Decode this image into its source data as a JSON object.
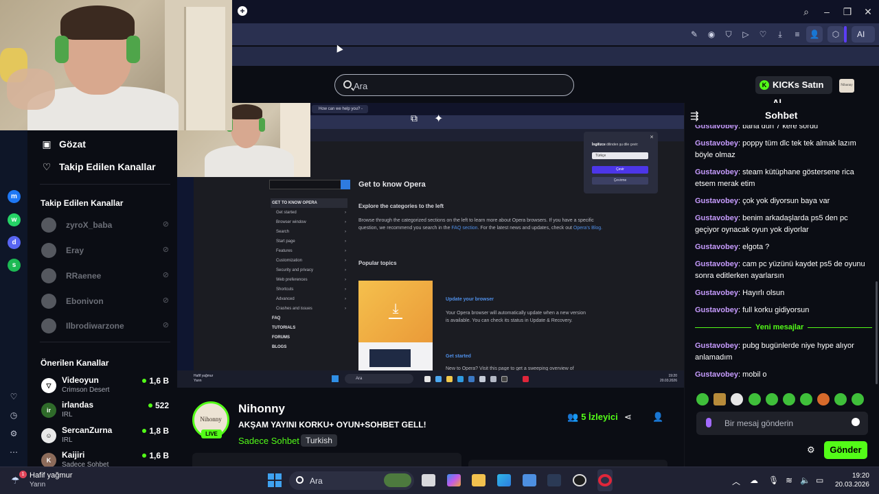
{
  "topbar": {
    "ai_label": "AI"
  },
  "kick": {
    "search_placeholder": "Ara",
    "kicks_button": "KICKs Satın Al",
    "mini_avatar_text": "Nihonny"
  },
  "sidebar": {
    "nav": [
      {
        "icon": "browse-icon",
        "label": "Gözat"
      },
      {
        "icon": "heart-icon",
        "label": "Takip Edilen Kanallar"
      }
    ],
    "followed_title": "Takip Edilen Kanallar",
    "followed": [
      "zyroX_baba",
      "Eray",
      "RRaenee",
      "Ebonivon",
      "Ilbrodiwarzone"
    ],
    "recommended_title": "Önerilen Kanallar",
    "recommended": [
      {
        "name": "Videoyun",
        "category": "Crimson Desert",
        "viewers": "1,6 B"
      },
      {
        "name": "irlandas",
        "category": "IRL",
        "viewers": "522"
      },
      {
        "name": "SercanZurna",
        "category": "IRL",
        "viewers": "1,8 B"
      },
      {
        "name": "Kaijiri",
        "category": "Sadece Sohbet",
        "viewers": "1,6 B"
      }
    ]
  },
  "video": {
    "tab_label": "How can we help you? -",
    "page_heading": "Get to know Opera",
    "explore_heading": "Explore the categories to the left",
    "explore_text": "Browse through the categorized sections on the left to learn more about Opera browsers. If you have a specific question, we recommend you search in the",
    "faq_link": "FAQ section",
    "explore_text2": ". For the latest news and updates, check out",
    "blog_link": "Opera's Blog.",
    "popular_heading": "Popular topics",
    "menu": [
      {
        "label": "GET TO KNOW OPERA",
        "top": true,
        "hl": true,
        "arrow": false
      },
      {
        "label": "Get started",
        "top": false,
        "hl": false,
        "arrow": true
      },
      {
        "label": "Browser window",
        "top": false,
        "hl": false,
        "arrow": true
      },
      {
        "label": "Search",
        "top": false,
        "hl": false,
        "arrow": true
      },
      {
        "label": "Start page",
        "top": false,
        "hl": false,
        "arrow": true
      },
      {
        "label": "Features",
        "top": false,
        "hl": false,
        "arrow": true
      },
      {
        "label": "Customization",
        "top": false,
        "hl": false,
        "arrow": true
      },
      {
        "label": "Security and privacy",
        "top": false,
        "hl": false,
        "arrow": true
      },
      {
        "label": "Web preferences",
        "top": false,
        "hl": false,
        "arrow": true
      },
      {
        "label": "Shortcuts",
        "top": false,
        "hl": false,
        "arrow": true
      },
      {
        "label": "Advanced",
        "top": false,
        "hl": false,
        "arrow": true
      },
      {
        "label": "Crashes and issues",
        "top": false,
        "hl": false,
        "arrow": true
      },
      {
        "label": "FAQ",
        "top": true,
        "hl": false,
        "arrow": false
      },
      {
        "label": "TUTORIALS",
        "top": true,
        "hl": false,
        "arrow": false
      },
      {
        "label": "FORUMS",
        "top": true,
        "hl": false,
        "arrow": false
      },
      {
        "label": "BLOGS",
        "top": true,
        "hl": false,
        "arrow": false
      }
    ],
    "update_title": "Update your browser",
    "update_text": "Your Opera browser will automatically update when a new version is available. You can check its status in Update & Recovery.",
    "get_started_title": "Get started",
    "get_started_text": "New to Opera? Visit this page to get a sweeping overview of",
    "popup": {
      "lang_bold": "İngilizce",
      "lang_rest": " dilinden şu dile çevir:",
      "selected": "Türkçe",
      "translate": "Çevir",
      "cancel": "Çevirme"
    },
    "taskbar_weather_1": "Hafif yağmur",
    "taskbar_weather_2": "Yarın",
    "taskbar_search": "Ara",
    "taskbar_time": "19:20",
    "taskbar_date": "20.03.2026"
  },
  "stream": {
    "logo_text": "Nihonny",
    "live": "LIVE",
    "channel": "Nihonny",
    "title": "AKŞAM YAYINI KORKU+ OYUN+SOHBET GELL!",
    "category": "Sadece Sohbet",
    "tag": "Turkish",
    "viewer_count": "5",
    "viewer_label": "İzleyici"
  },
  "chat": {
    "title": "Sohbet",
    "messages": [
      {
        "user": "Gustavobey",
        "text": "bana dün 7 kere sordu"
      },
      {
        "user": "Gustavobey",
        "text": "poppy tüm dlc tek tek almak lazım böyle olmaz"
      },
      {
        "user": "Gustavobey",
        "text": "steam kütüphane göstersene rica etsem merak etim"
      },
      {
        "user": "Gustavobey",
        "text": "çok yok diyorsun baya var"
      },
      {
        "user": "Gustavobey",
        "text": "benim arkadaşlarda ps5 den pc geçiyor oynacak oyun yok diyorlar"
      },
      {
        "user": "Gustavobey",
        "text": "elgota ?"
      },
      {
        "user": "Gustavobey",
        "text": "cam pc yüzünü kaydet ps5 de oyunu sonra editlerken ayarlarsın"
      },
      {
        "user": "Gustavobey",
        "text": "Hayırlı olsun"
      },
      {
        "user": "Gustavobey",
        "text": "full korku gidiyorsun"
      }
    ],
    "new_messages_label": "Yeni mesajlar",
    "new_messages": [
      {
        "user": "Gustavobey",
        "text": "pubg bugünlerde niye hype alıyor anlamadım"
      },
      {
        "user": "Gustavobey",
        "text": "mobil o"
      }
    ],
    "input_placeholder": "Bir mesaj gönderin",
    "send_label": "Gönder"
  },
  "windows": {
    "weather_badge": "1",
    "weather_line1": "Hafif yağmur",
    "weather_line2": "Yarın",
    "search_placeholder": "Ara",
    "time": "19:20",
    "date": "20.03.2026"
  }
}
